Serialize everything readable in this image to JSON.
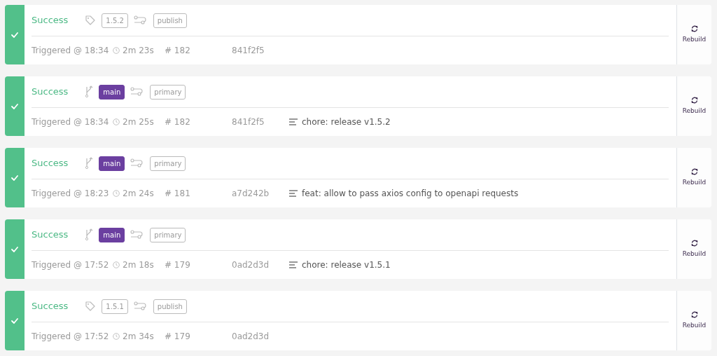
{
  "builds": [
    {
      "status": "Success",
      "kind": "tag",
      "ref": "1.5.2",
      "pipeline": "publish",
      "triggered": "Triggered @ 18:34",
      "duration": "2m 23s",
      "number": "# 182",
      "commit": "841f2f5",
      "action": "Rebuild"
    },
    {
      "status": "Success",
      "kind": "branch",
      "ref": "main",
      "pipeline": "primary",
      "triggered": "Triggered @ 18:34",
      "duration": "2m 25s",
      "number": "# 182",
      "commit": "841f2f5",
      "message": "chore: release v1.5.2",
      "action": "Rebuild"
    },
    {
      "status": "Success",
      "kind": "branch",
      "ref": "main",
      "pipeline": "primary",
      "triggered": "Triggered @ 18:23",
      "duration": "2m 24s",
      "number": "# 181",
      "commit": "a7d242b",
      "message": "feat: allow to pass axios config to openapi requests",
      "action": "Rebuild"
    },
    {
      "status": "Success",
      "kind": "branch",
      "ref": "main",
      "pipeline": "primary",
      "triggered": "Triggered @ 17:52",
      "duration": "2m 18s",
      "number": "# 179",
      "commit": "0ad2d3d",
      "message": "chore: release v1.5.1",
      "action": "Rebuild"
    },
    {
      "status": "Success",
      "kind": "tag",
      "ref": "1.5.1",
      "pipeline": "publish",
      "triggered": "Triggered @ 17:52",
      "duration": "2m 34s",
      "number": "# 179",
      "commit": "0ad2d3d",
      "action": "Rebuild"
    }
  ]
}
